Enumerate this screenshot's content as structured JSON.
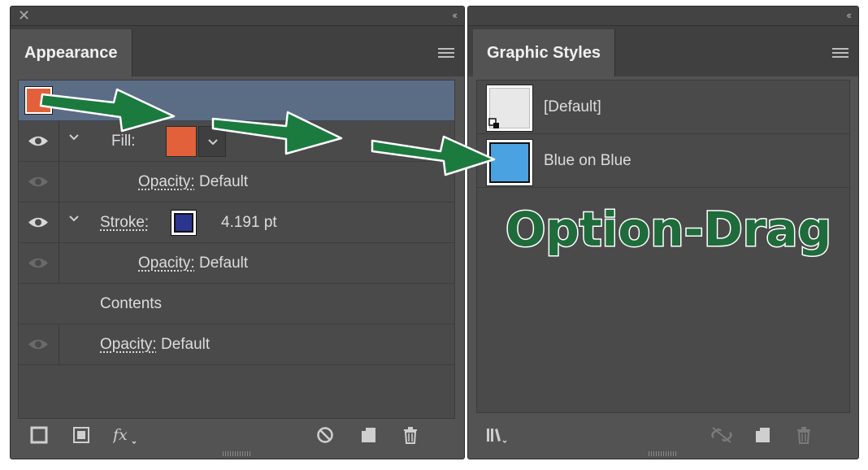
{
  "appearance": {
    "title": "Appearance",
    "fill_label": "Fill:",
    "opacity_label": "Opacity:",
    "opacity_value": "Default",
    "stroke_label": "Stroke:",
    "stroke_weight": "4.191 pt",
    "contents_label": "Contents",
    "colors": {
      "fill": "#e2603a",
      "stroke": "#2b3590"
    }
  },
  "graphic_styles": {
    "title": "Graphic Styles",
    "items": [
      {
        "label": "[Default]",
        "color": "#e8e8e8"
      },
      {
        "label": "Blue on Blue",
        "color": "#4aa3e0"
      }
    ]
  },
  "annotation": {
    "text": "Option-Drag",
    "text_color": "#1f6b3b",
    "arrow_color": "#1b7a3e"
  },
  "icons": [
    "close-icon",
    "collapse-icon",
    "panel-menu-icon",
    "visibility-eye-icon",
    "disclosure-chevron-icon",
    "add-new-stroke-icon",
    "add-new-fill-icon",
    "fx-icon",
    "clear-appearance-icon",
    "duplicate-item-icon",
    "delete-icon",
    "graphic-styles-library-icon",
    "break-link-icon",
    "new-graphic-style-icon"
  ]
}
